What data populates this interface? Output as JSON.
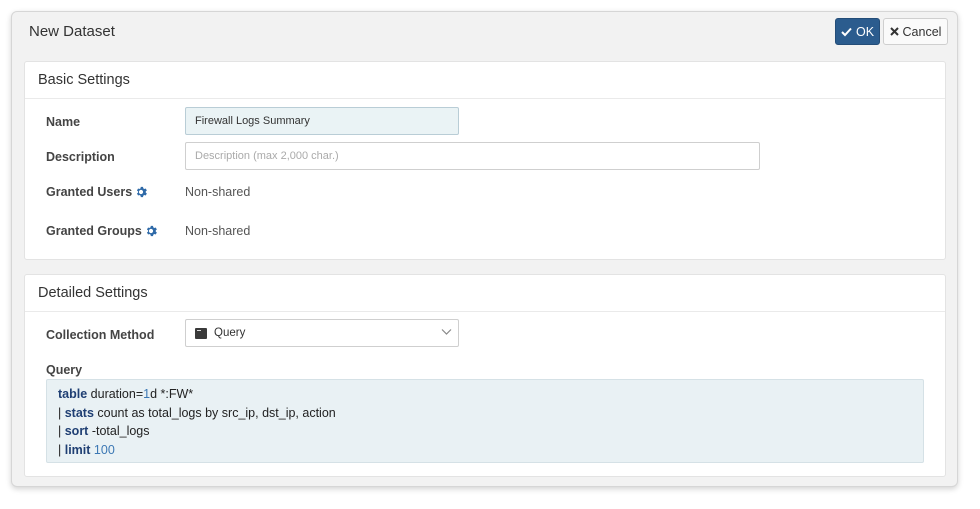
{
  "dialog": {
    "title": "New Dataset",
    "ok_label": "OK",
    "cancel_label": "Cancel"
  },
  "basic": {
    "section_title": "Basic Settings",
    "name_label": "Name",
    "name_value": "Firewall Logs Summary",
    "description_label": "Description",
    "description_placeholder": "Description (max 2,000 char.)",
    "granted_users_label": "Granted Users",
    "granted_users_value": "Non-shared",
    "granted_groups_label": "Granted Groups",
    "granted_groups_value": "Non-shared"
  },
  "detailed": {
    "section_title": "Detailed Settings",
    "collection_method_label": "Collection Method",
    "collection_method_value": "Query",
    "query_label": "Query",
    "query_lines": [
      {
        "pre": "",
        "kw": "table",
        "mid": " duration=",
        "num": "1",
        "post": "d *:FW*"
      },
      {
        "pre": "| ",
        "kw": "stats",
        "mid": " count as total_logs by src_ip, dst_ip, action",
        "num": "",
        "post": ""
      },
      {
        "pre": "| ",
        "kw": "sort",
        "mid": " -total_logs",
        "num": "",
        "post": ""
      },
      {
        "pre": "| ",
        "kw": "limit",
        "mid": " ",
        "num": "100",
        "post": ""
      }
    ]
  },
  "icons": {
    "ok": "check-icon",
    "cancel": "close-icon",
    "users_settings": "gear-icon",
    "groups_settings": "gear-icon",
    "collection": "terminal-icon",
    "dropdown": "chevron-down-icon"
  },
  "colors": {
    "primary": "#2b5c8e",
    "keyword": "#1f3f73",
    "number": "#3c78b4",
    "gear": "#2f6aa8"
  }
}
